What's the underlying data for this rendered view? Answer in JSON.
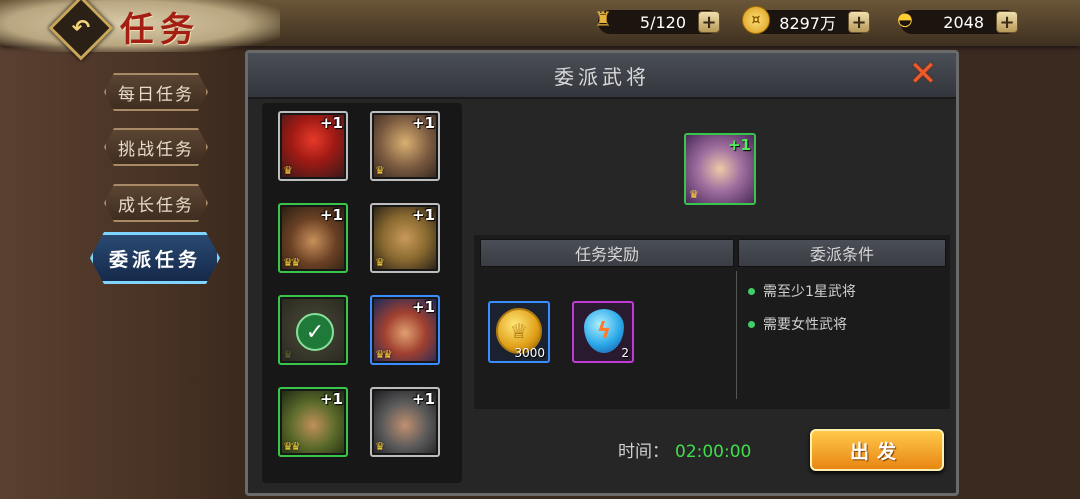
{
  "header": {
    "title": "任务",
    "resources": [
      {
        "icon": "trophy-icon",
        "value": "5/120"
      },
      {
        "icon": "copper-coin-icon",
        "value": "8297万"
      },
      {
        "icon": "gold-ingot-icon",
        "value": "2048"
      }
    ]
  },
  "tabs": [
    {
      "label": "每日任务",
      "active": false
    },
    {
      "label": "挑战任务",
      "active": false
    },
    {
      "label": "成长任务",
      "active": false
    },
    {
      "label": "委派任务",
      "active": true
    }
  ],
  "dialog": {
    "title": "委派武将",
    "heroes": [
      {
        "name_icon": "red-mask-hero",
        "border": "#bdbdbd",
        "plus": "+1",
        "stars": 1,
        "used": false
      },
      {
        "name_icon": "beast-hero",
        "border": "#bdbdbd",
        "plus": "+1",
        "stars": 1,
        "used": false
      },
      {
        "name_icon": "gold-helmet-hero",
        "border": "#39c54a",
        "plus": "+1",
        "stars": 2,
        "used": false
      },
      {
        "name_icon": "bearded-general-hero",
        "border": "#bdbdbd",
        "plus": "+1",
        "stars": 1,
        "used": false
      },
      {
        "name_icon": "assigned-hero",
        "border": "#39c54a",
        "plus": "",
        "stars": 1,
        "used": true
      },
      {
        "name_icon": "red-headband-hero",
        "border": "#3a8cff",
        "plus": "+1",
        "stars": 2,
        "used": false
      },
      {
        "name_icon": "green-armor-hero",
        "border": "#39c54a",
        "plus": "+1",
        "stars": 2,
        "used": false
      },
      {
        "name_icon": "iron-helmet-hero",
        "border": "#bdbdbd",
        "plus": "+1",
        "stars": 1,
        "used": false
      }
    ],
    "selected_hero": {
      "name_icon": "female-general-hero",
      "plus": "+1",
      "stars": 1
    },
    "reward_header": "任务奖励",
    "condition_header": "委派条件",
    "rewards": [
      {
        "icon": "gold-coin-icon",
        "count": "3000",
        "border": "#3a8cff"
      },
      {
        "icon": "blue-crystal-icon",
        "count": "2",
        "border": "#c23ad6"
      }
    ],
    "conditions": [
      "需至少1星武将",
      "需要女性武将"
    ],
    "time_label": "时间：",
    "time_value": "02:00:00",
    "go_button": "出发"
  }
}
